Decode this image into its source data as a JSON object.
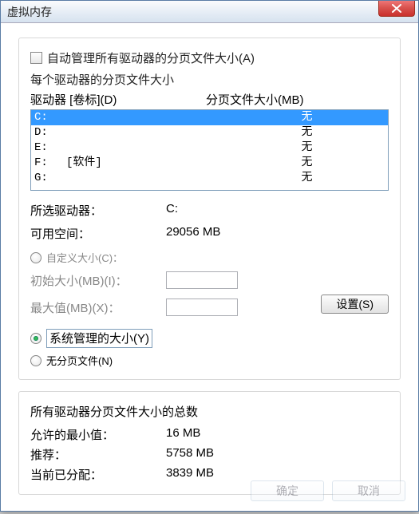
{
  "window": {
    "title": "虚拟内存"
  },
  "auto_manage": {
    "label": "自动管理所有驱动器的分页文件大小(A)",
    "checked": false
  },
  "per_drive_heading": "每个驱动器的分页文件大小",
  "columns": {
    "drive": "驱动器 [卷标](D)",
    "page": "分页文件大小(MB)"
  },
  "drives": [
    {
      "letter": "C:",
      "label": "",
      "page": "无",
      "selected": true
    },
    {
      "letter": "D:",
      "label": "",
      "page": "无",
      "selected": false
    },
    {
      "letter": "E:",
      "label": "",
      "page": "无",
      "selected": false
    },
    {
      "letter": "F:",
      "label": "[软件]",
      "page": "无",
      "selected": false
    },
    {
      "letter": "G:",
      "label": "",
      "page": "无",
      "selected": false
    }
  ],
  "selected": {
    "drive_label": "所选驱动器：",
    "drive_value": "C:",
    "free_label": "可用空间：",
    "free_value": "29056 MB"
  },
  "custom": {
    "label": "自定义大小(C)：",
    "initial_label": "初始大小(MB)(I)：",
    "max_label": "最大值(MB)(X)：",
    "initial_value": "",
    "max_value": ""
  },
  "managed": {
    "label": "系统管理的大小(Y)"
  },
  "none": {
    "label": "无分页文件(N)"
  },
  "set_btn": "设置(S)",
  "totals": {
    "title": "所有驱动器分页文件大小的总数",
    "min_label": "允许的最小值：",
    "min_value": "16 MB",
    "rec_label": "推荐：",
    "rec_value": "5758 MB",
    "cur_label": "当前已分配：",
    "cur_value": "3839 MB"
  },
  "footer": {
    "ok": "确定",
    "cancel": "取消"
  }
}
